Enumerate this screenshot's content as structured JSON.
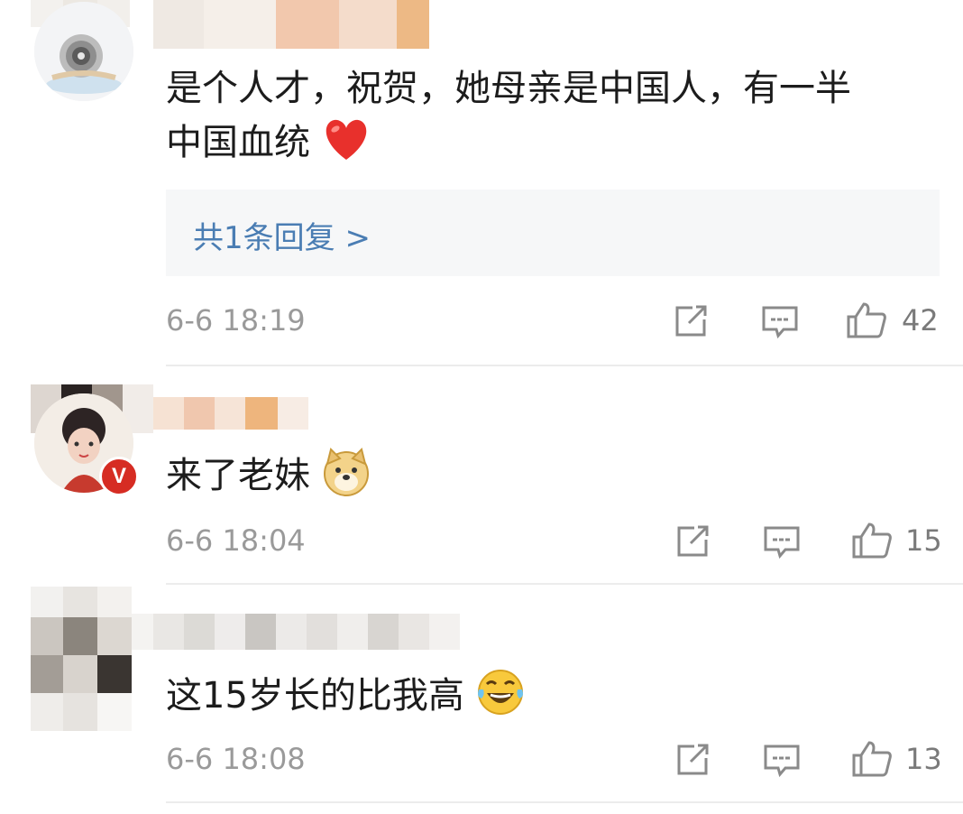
{
  "comments": [
    {
      "text_line1": "是个人才，祝贺，她母亲是中国人，有一半",
      "text_line2": "中国血统",
      "emoji": "heart",
      "reply_label": "共1条回复 >",
      "time": "6-6 18:19",
      "likes": "42"
    },
    {
      "text": "来了老妹",
      "emoji": "doge",
      "verified_badge": "V",
      "time": "6-6 18:04",
      "likes": "15"
    },
    {
      "text": "这15岁长的比我高",
      "emoji": "laughing-tears",
      "time": "6-6 18:08",
      "likes": "13"
    }
  ],
  "icons": [
    "share-icon",
    "comment-icon",
    "like-icon"
  ],
  "colors": {
    "link": "#4a7db3",
    "meta": "#9a9a9a",
    "icon": "#8a8a8a",
    "reply_bg": "#f6f7f8",
    "verified": "#d62c23",
    "heart": "#e8302c"
  }
}
